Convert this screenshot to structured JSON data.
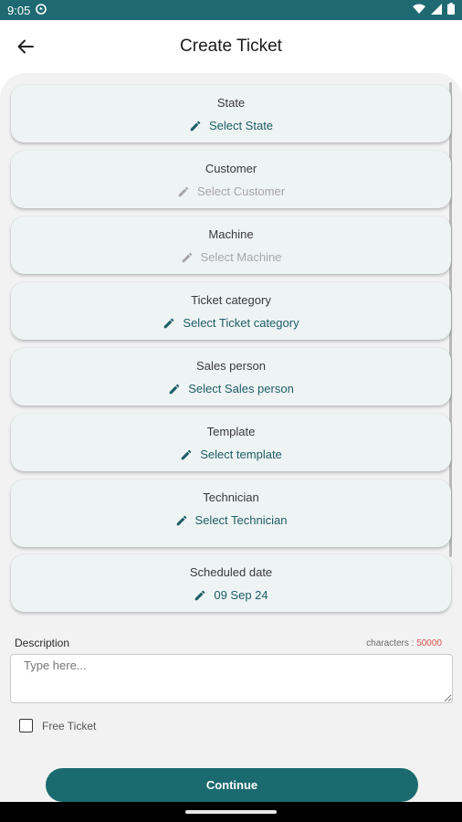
{
  "status_bar": {
    "time": "9:05"
  },
  "app_bar": {
    "title": "Create Ticket"
  },
  "cards": [
    {
      "label": "State",
      "value": "Select  State",
      "enabled": true
    },
    {
      "label": "Customer",
      "value": "Select  Customer",
      "enabled": false
    },
    {
      "label": "Machine",
      "value": "Select  Machine",
      "enabled": false
    },
    {
      "label": "Ticket category",
      "value": "Select  Ticket category",
      "enabled": true
    },
    {
      "label": "Sales person",
      "value": "Select  Sales person",
      "enabled": true
    },
    {
      "label": "Template",
      "value": "Select template",
      "enabled": true
    },
    {
      "label": "Technician",
      "value": "Select  Technician",
      "enabled": true
    },
    {
      "label": "Scheduled date",
      "value": "09 Sep 24",
      "enabled": true
    }
  ],
  "description": {
    "label": "Description",
    "chars_label": "characters : ",
    "chars_count": "50000",
    "placeholder": "Type here..."
  },
  "free_ticket": {
    "label": "Free Ticket",
    "checked": false
  },
  "continue_label": "Continue",
  "colors": {
    "primary": "#1b6a70",
    "status_bar": "#1f6a72",
    "card_bg": "#eef3f3",
    "accent_text": "#1d5d66",
    "disabled_text": "#a7a7a7",
    "char_count": "#d9534f"
  }
}
